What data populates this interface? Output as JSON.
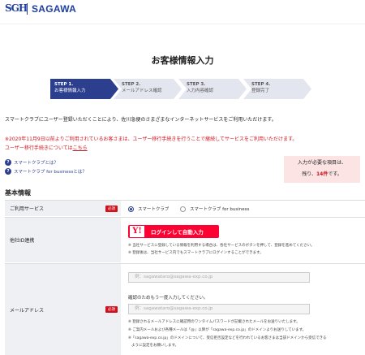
{
  "header": {
    "logo_mark": "SGH",
    "logo_name": "SAGAWA"
  },
  "page_title": "お客様情報入力",
  "steps": [
    {
      "num": "STEP 1.",
      "label": "お客様情報入力",
      "active": true
    },
    {
      "num": "STEP 2.",
      "label": "メールアドレス確認",
      "active": false
    },
    {
      "num": "STEP 3.",
      "label": "入力内容確認",
      "active": false
    },
    {
      "num": "STEP 4.",
      "label": "登録完了",
      "active": false
    }
  ],
  "intro": "スマートクラブにユーザー登録いただくことにより、佐川急便のさまざまなインターネットサービスをご利用いただけます。",
  "notice": {
    "line1": "※2020年11月9日以前よりご利用されているお客さまは、ユーザー移行手続きを行うことで継続してサービスをご利用いただけます。",
    "line2_text": "ユーザー移行手続きについては",
    "line2_link": "こちら"
  },
  "help_links": [
    {
      "icon": "question-circle-icon",
      "label": "スマートクラブとは？"
    },
    {
      "icon": "question-circle-icon",
      "label": "スマートクラブ for businessとは？"
    }
  ],
  "required_box": {
    "line1": "入力が必要な項目は、",
    "prefix": "残り、",
    "count": "14件",
    "suffix": "です。"
  },
  "section_title": "基本情報",
  "form": {
    "required_label": "必須",
    "service": {
      "label": "ご利用サービス",
      "options": [
        "スマートクラブ",
        "スマートクラブ for business"
      ],
      "selected": "スマートクラブ"
    },
    "external_id": {
      "label": "他社ID連携",
      "yahoo_logo": "Y!",
      "yahoo_button": "ログインして自動入力",
      "note1": "※ 当社サービスに登録している情報を利用する場合は、各社サービスのボタンを押して、登録を進めてください。",
      "note2": "※ 登録後は、当社サービス内でもスマートクラブにログインすることができます。"
    },
    "email": {
      "label": "メールアドレス",
      "placeholder": "例：sagawataro@sagawa-exp.co.jp",
      "confirm_text": "確認のためもう一度入力してください。",
      "confirm_placeholder": "例：sagawataro@sagawa-exp.co.jp",
      "note1": "※ 登録されるメールアドレスに確認用のワンタイムパスワードが記載されたメールをお送りいたします。",
      "note2": "※ ご案内メールおよび各種メールは「@」以降が「sagawa-exp.co.jp」のドメインよりお送りしています。",
      "note3": "※「sagawa-exp.co.jp」のドメインについて、受信拒否設定などを行われているお客さまは当該ドメインから受信できる",
      "note4": "ように設定をお願いします。"
    }
  },
  "colors": {
    "brand": "#1e3ea0",
    "step_active": "#2c3f8f",
    "alert": "#d0101b",
    "yahoo": "#ff0033"
  }
}
